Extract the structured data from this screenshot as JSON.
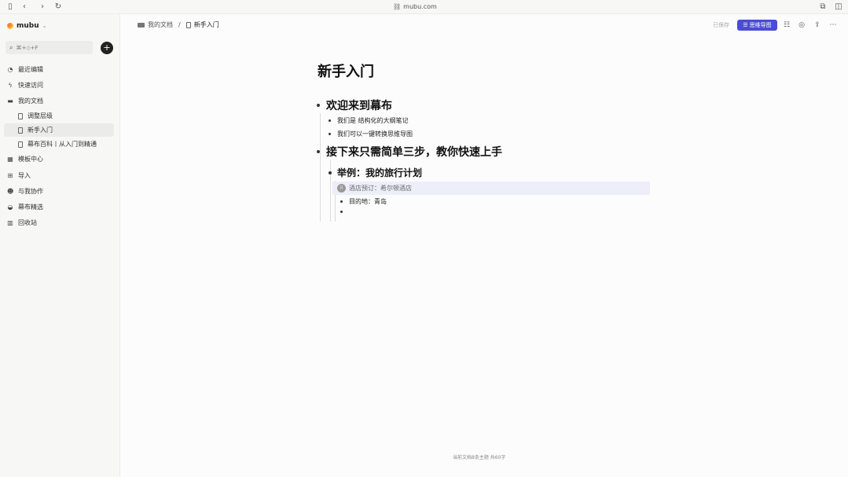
{
  "browser": {
    "url": "mubu.com"
  },
  "sidebar": {
    "brand": "mubu",
    "search_placeholder": "⌘+◇+F",
    "nav": [
      {
        "label": "最近编辑"
      },
      {
        "label": "快速访问"
      },
      {
        "label": "我的文档"
      }
    ],
    "docs": [
      {
        "label": "调整层级"
      },
      {
        "label": "新手入门"
      },
      {
        "label": "幕布百科丨从入门到精通"
      }
    ],
    "more": [
      {
        "label": "模板中心"
      },
      {
        "label": "导入"
      },
      {
        "label": "与我协作"
      },
      {
        "label": "幕布精选"
      },
      {
        "label": "回收站"
      }
    ]
  },
  "topbar": {
    "breadcrumb_parent": "我的文档",
    "breadcrumb_sep": "/",
    "breadcrumb_current": "新手入门",
    "saved": "已保存",
    "mindmap_label": "思维导图"
  },
  "document": {
    "title": "新手入门",
    "n1": "欢迎来到幕布",
    "n1_1": "我们是 结构化的大纲笔记",
    "n1_2": "我们可以一键转换思维导图",
    "n2": "接下来只需简单三步，教你快速上手",
    "n2_1": "举例：我的旅行计划",
    "n2_1_1": "酒店预订：希尔顿酒店",
    "n2_1_2": "目的地：青岛"
  },
  "footer": "当前文档8条主题 共60字"
}
